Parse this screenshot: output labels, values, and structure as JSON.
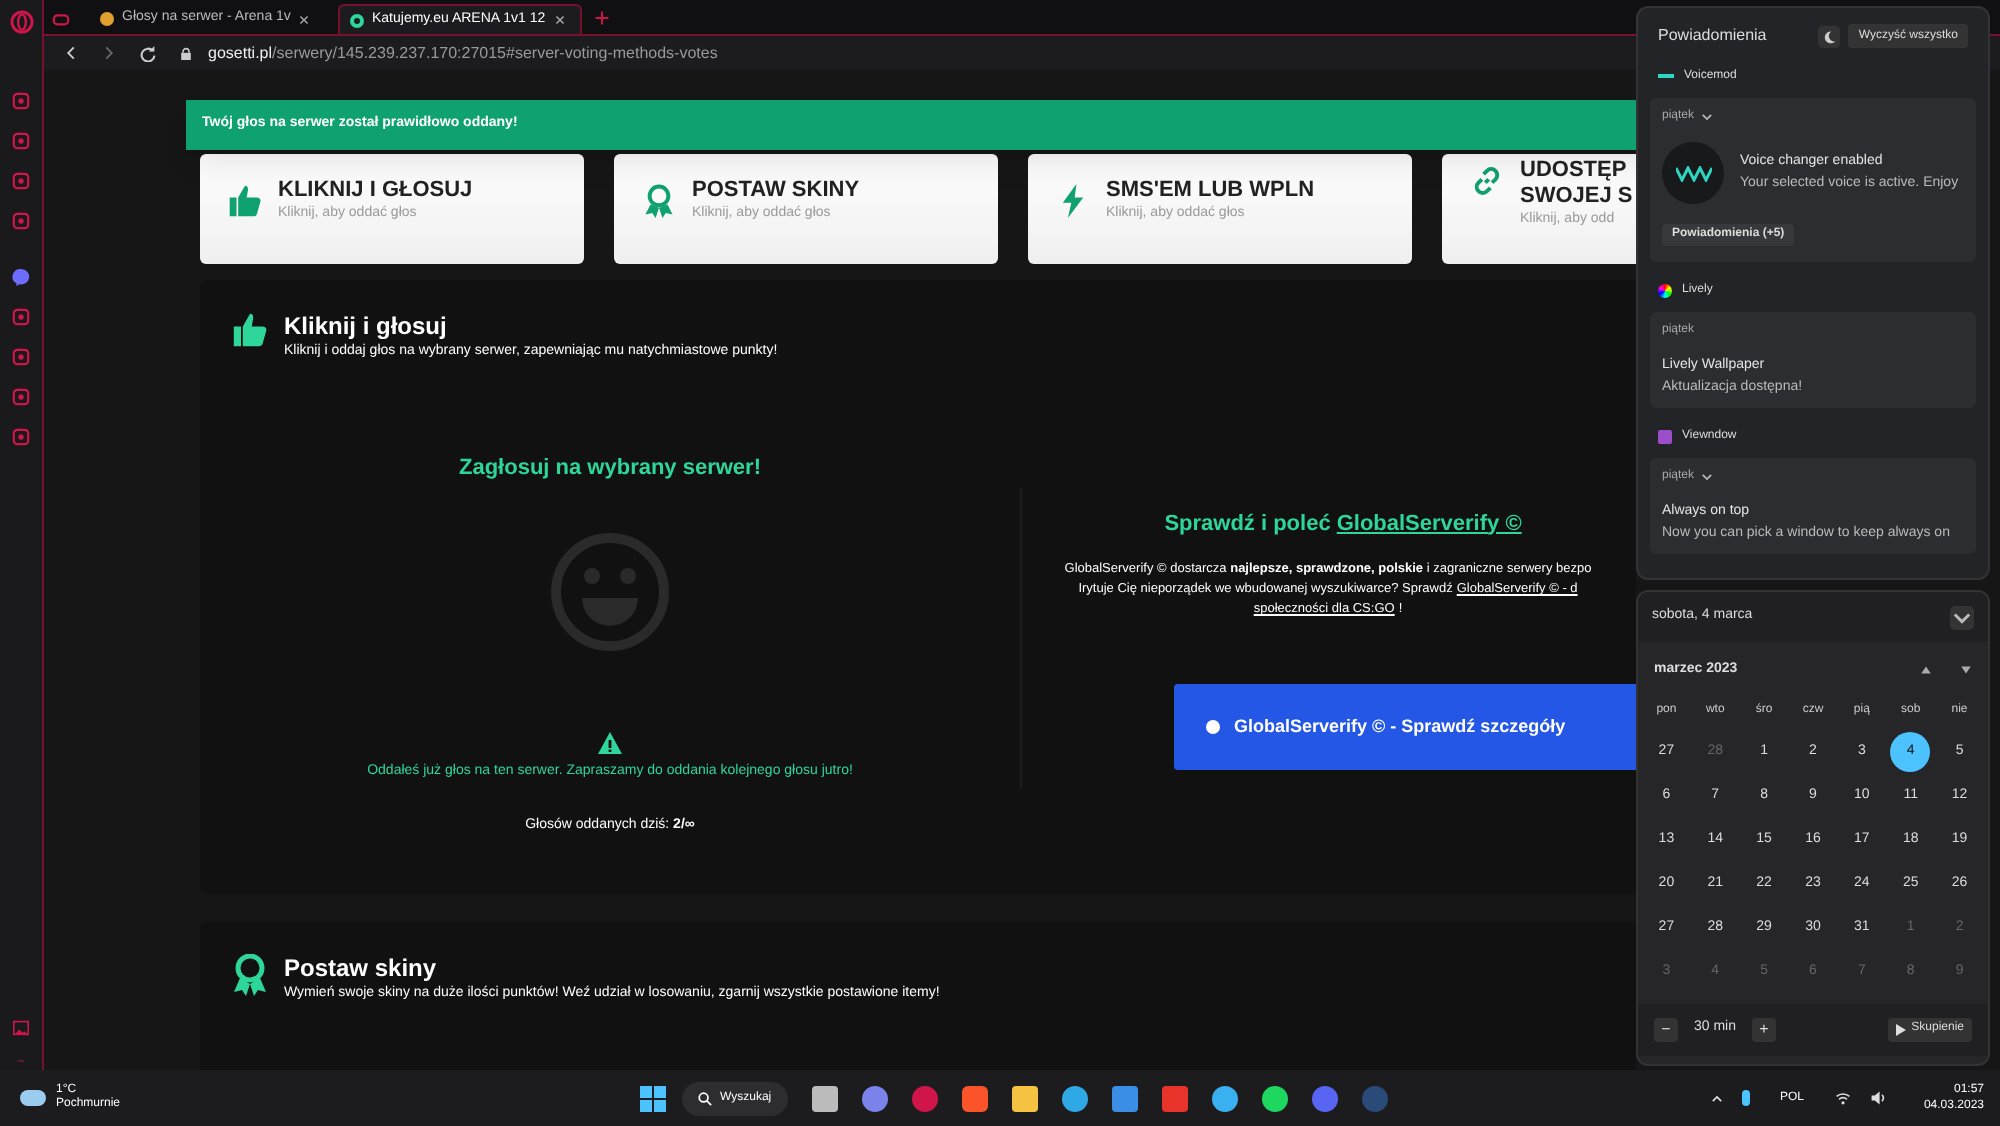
{
  "browser": {
    "tabs": [
      {
        "title": "Głosy na serwer - Arena 1v",
        "selected": false
      },
      {
        "title": "Katujemy.eu ARENA 1v1 12",
        "selected": true
      }
    ],
    "address_host": "gosetti.pl",
    "address_path": "/serwery/145.239.237.170:27015#server-voting-methods-votes"
  },
  "toast": "Twój głos na serwer został prawidłowo oddany!",
  "method_cards": [
    {
      "kind": "thumb",
      "title": [
        "KLIKNIJ I GŁOSUJ"
      ],
      "subtitle": "Kliknij, aby oddać głos"
    },
    {
      "kind": "award",
      "title": [
        "POSTAW SKINY"
      ],
      "subtitle": "Kliknij, aby oddać głos"
    },
    {
      "kind": "bolt",
      "title": [
        "SMS'EM LUB WPLN"
      ],
      "subtitle": "Kliknij, aby oddać głos"
    },
    {
      "kind": "link",
      "title": [
        "UDOSTĘP",
        "SWOJEJ S"
      ],
      "subtitle": "Kliknij, aby odd"
    }
  ],
  "vote_section": {
    "title": "Kliknij i głosuj",
    "subtitle": "Kliknij i oddaj głos na wybrany serwer, zapewniając mu natychmiastowe punkty!",
    "heading": "Zagłosuj na wybrany serwer!",
    "warning": "Oddałeś już głos na ten serwer. Zapraszamy do oddania kolejnego głosu jutro!",
    "count": "Głosów oddanych dziś: **2/∞**",
    "promo": {
      "heading": "Sprawdź i poleć",
      "heading_link": "GlobalServerify ©",
      "lines": [
        [
          {
            "text": "GlobalServerify © dostarcza **najlepsze, sprawdzone, polskie** i zagraniczne serwery bezpo",
            "link": false
          }
        ],
        [
          {
            "text": "Irytuje Cię nieporządek we wbudowanej wyszukiwarce? Sprawdź",
            "link": false
          },
          {
            "text": "GlobalServerify © - d",
            "link": true
          }
        ],
        [
          {
            "text": "społeczności dla CS:GO",
            "link": true
          },
          {
            "text": "!",
            "link": false
          }
        ]
      ],
      "button": "GlobalServerify © - Sprawdź szczegóły"
    }
  },
  "skins_section": {
    "title": "Postaw skiny",
    "subtitle": "Wymień swoje skiny na duże ilości punktów! Weź udział w losowaniu, zgarnij wszystkie postawione itemy!"
  },
  "notifications": {
    "title": "Powiadomienia",
    "clear_button": "Wyczyść wszystko",
    "groups": [
      {
        "app": "Voicemod",
        "kind": "voicemod",
        "day": "piątek",
        "expandable": true,
        "title": "Voice changer enabled",
        "body": "Your selected voice is active. Enjoy",
        "more_button": "Powiadomienia (+5)"
      },
      {
        "app": "Lively",
        "kind": "lively",
        "day": "piątek",
        "expandable": false,
        "title": "Lively Wallpaper",
        "body": "Aktualizacja dostępna!"
      },
      {
        "app": "Viewndow",
        "kind": "viewndow",
        "day": "piątek",
        "expandable": true,
        "title": "Always on top",
        "body": "Now you can pick a window to keep always on"
      }
    ]
  },
  "calendar": {
    "date": "sobota, 4 marca",
    "month": "marzec 2023",
    "weekdays": [
      "pon",
      "wto",
      "śro",
      "czw",
      "pią",
      "sob",
      "nie"
    ],
    "days": [
      {
        "d": "27",
        "muted": false,
        "selected": false
      },
      {
        "d": "28",
        "muted": true,
        "selected": false
      },
      {
        "d": "1",
        "muted": false,
        "selected": false
      },
      {
        "d": "2",
        "muted": false,
        "selected": false
      },
      {
        "d": "3",
        "muted": false,
        "selected": false
      },
      {
        "d": "4",
        "muted": false,
        "selected": true
      },
      {
        "d": "5",
        "muted": false,
        "selected": false
      },
      {
        "d": "6",
        "muted": false,
        "selected": false
      },
      {
        "d": "7",
        "muted": false,
        "selected": false
      },
      {
        "d": "8",
        "muted": false,
        "selected": false
      },
      {
        "d": "9",
        "muted": false,
        "selected": false
      },
      {
        "d": "10",
        "muted": false,
        "selected": false
      },
      {
        "d": "11",
        "muted": false,
        "selected": false
      },
      {
        "d": "12",
        "muted": false,
        "selected": false
      },
      {
        "d": "13",
        "muted": false,
        "selected": false
      },
      {
        "d": "14",
        "muted": false,
        "selected": false
      },
      {
        "d": "15",
        "muted": false,
        "selected": false
      },
      {
        "d": "16",
        "muted": false,
        "selected": false
      },
      {
        "d": "17",
        "muted": false,
        "selected": false
      },
      {
        "d": "18",
        "muted": false,
        "selected": false
      },
      {
        "d": "19",
        "muted": false,
        "selected": false
      },
      {
        "d": "20",
        "muted": false,
        "selected": false
      },
      {
        "d": "21",
        "muted": false,
        "selected": false
      },
      {
        "d": "22",
        "muted": false,
        "selected": false
      },
      {
        "d": "23",
        "muted": false,
        "selected": false
      },
      {
        "d": "24",
        "muted": false,
        "selected": false
      },
      {
        "d": "25",
        "muted": false,
        "selected": false
      },
      {
        "d": "26",
        "muted": false,
        "selected": false
      },
      {
        "d": "27",
        "muted": false,
        "selected": false
      },
      {
        "d": "28",
        "muted": false,
        "selected": false
      },
      {
        "d": "29",
        "muted": false,
        "selected": false
      },
      {
        "d": "30",
        "muted": false,
        "selected": false
      },
      {
        "d": "31",
        "muted": false,
        "selected": false
      },
      {
        "d": "1",
        "muted": true,
        "selected": false
      },
      {
        "d": "2",
        "muted": true,
        "selected": false
      },
      {
        "d": "3",
        "muted": true,
        "selected": false
      },
      {
        "d": "4",
        "muted": true,
        "selected": false
      },
      {
        "d": "5",
        "muted": true,
        "selected": false
      },
      {
        "d": "6",
        "muted": true,
        "selected": false
      },
      {
        "d": "7",
        "muted": true,
        "selected": false
      },
      {
        "d": "8",
        "muted": true,
        "selected": false
      },
      {
        "d": "9",
        "muted": true,
        "selected": false
      }
    ],
    "focus_minus": "−",
    "focus_time": "30 min",
    "focus_plus": "+",
    "focus_button": "Skupienie"
  },
  "taskbar": {
    "temperature": "1°C",
    "weather": "Pochmurnie",
    "search": "Wyszukaj",
    "language": "POL",
    "time": "01:57",
    "date": "04.03.2023"
  }
}
